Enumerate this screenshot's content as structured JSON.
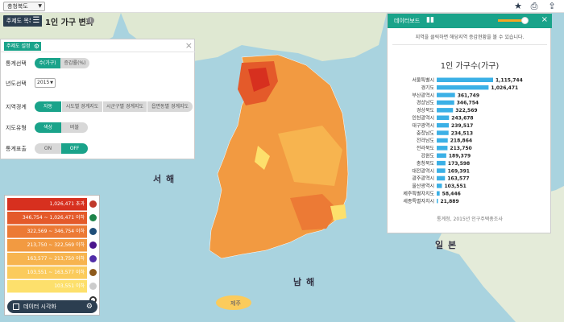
{
  "topbar": {
    "region": "충청북도",
    "icons": [
      "star-icon",
      "print-icon",
      "share-icon"
    ]
  },
  "title_row": {
    "theme_label": "주제도 목록",
    "page_title": "1인 가구 변화",
    "info_glyph": "i"
  },
  "settings": {
    "title": "주제도 설정",
    "rows": [
      {
        "label": "통계선택",
        "options": [
          "수(가구)",
          "증감률(%)"
        ],
        "selected": 0
      },
      {
        "label": "년도선택",
        "select_value": "2015"
      },
      {
        "label": "지역경계",
        "options": [
          "자동",
          "시도별 경계지도",
          "시군구별 경계지도",
          "읍면동별 경계지도"
        ],
        "selected": 0
      },
      {
        "label": "지도유형",
        "options": [
          "색상",
          "버블"
        ],
        "selected": 0
      },
      {
        "label": "통계표출",
        "options": [
          "ON",
          "OFF"
        ],
        "selected": 1
      }
    ]
  },
  "legend": {
    "rows": [
      {
        "label": "1,026,471 초과",
        "color": "#d7301f"
      },
      {
        "label": "346,754 ~ 1,026,471 이하",
        "color": "#e45a2a"
      },
      {
        "label": "322,569 ~ 346,754 이하",
        "color": "#ec7a35"
      },
      {
        "label": "213,750 ~ 322,569 이하",
        "color": "#f29a41"
      },
      {
        "label": "163,577 ~ 213,750 이하",
        "color": "#f7b44f"
      },
      {
        "label": "103,551 ~ 163,577 이하",
        "color": "#fbcb5c"
      },
      {
        "label": "103,551 이하",
        "color": "#fde06c"
      }
    ],
    "dot_colors": [
      "#c0392b",
      "#1e8449",
      "#1f4e79",
      "#4a148c",
      "#512da8",
      "#8e5a1c",
      "#cccccc"
    ],
    "viz_button": "데이터 시각화"
  },
  "dashboard": {
    "title": "데이터보드",
    "hint": "지역을 클릭하면 해당지역 증감현황을 볼 수 있습니다.",
    "source": "통계청, 2015년 인구주택총조사"
  },
  "chart_data": {
    "type": "bar",
    "orientation": "horizontal",
    "title": "1인 가구수(가구)",
    "categories": [
      "서울특별시",
      "경기도",
      "부산광역시",
      "경상남도",
      "경상북도",
      "인천광역시",
      "대구광역시",
      "충청남도",
      "전라남도",
      "전라북도",
      "강원도",
      "충청북도",
      "대전광역시",
      "광주광역시",
      "울산광역시",
      "제주특별자치도",
      "세종특별자치시"
    ],
    "values": [
      1115744,
      1026471,
      361749,
      346754,
      322569,
      243678,
      239517,
      234513,
      218864,
      213750,
      189379,
      173598,
      169391,
      163577,
      103551,
      58446,
      21889
    ],
    "value_labels": [
      "1,115,744",
      "1,026,471",
      "361,749",
      "346,754",
      "322,569",
      "243,678",
      "239,517",
      "234,513",
      "218,864",
      "213,750",
      "189,379",
      "173,598",
      "169,391",
      "163,577",
      "103,551",
      "58,446",
      "21,889"
    ],
    "bar_color": "#3bb0e6",
    "xlim": [
      0,
      1115744
    ]
  },
  "map": {
    "labels": {
      "west_sea": "서 해",
      "south_sea": "남 해",
      "japan": "일 본",
      "jeju": "제주"
    }
  }
}
